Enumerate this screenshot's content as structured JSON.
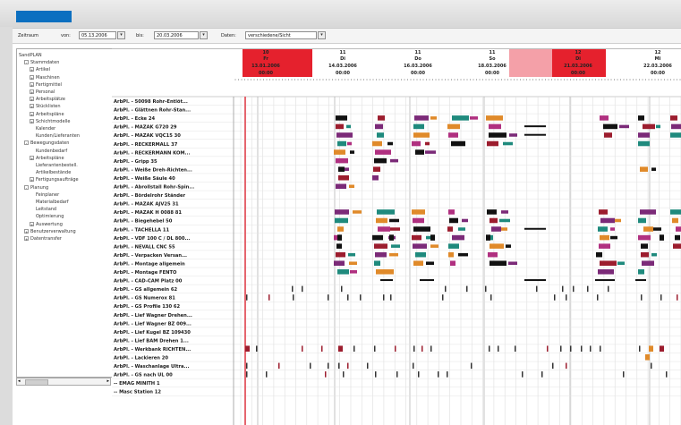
{
  "toolbar": {
    "zeitraum_label": "Zeitraum",
    "von_label": "von:",
    "von_value": "05.13.2006",
    "bis_label": "bis:",
    "bis_value": "20.03.2006",
    "daten_label": "Daten:",
    "daten_value": "verschiedene/Sicht"
  },
  "tree": [
    {
      "label": "SandPLAN",
      "toggle": "",
      "level": 0
    },
    {
      "label": "Stammdaten",
      "toggle": "-",
      "level": 1
    },
    {
      "label": "Artikel",
      "toggle": "+",
      "level": 2
    },
    {
      "label": "Maschinen",
      "toggle": "+",
      "level": 2
    },
    {
      "label": "Fertigmittel",
      "toggle": "+",
      "level": 2
    },
    {
      "label": "Personal",
      "toggle": "+",
      "level": 2
    },
    {
      "label": "Arbeitsplätze",
      "toggle": "+",
      "level": 2
    },
    {
      "label": "Stücklisten",
      "toggle": "+",
      "level": 2
    },
    {
      "label": "Arbeitspläne",
      "toggle": "+",
      "level": 2
    },
    {
      "label": "Schichtmodelle",
      "toggle": "+",
      "level": 2
    },
    {
      "label": "Kalender",
      "toggle": "",
      "level": 2
    },
    {
      "label": "Kunden/Lieferanten",
      "toggle": "",
      "level": 2
    },
    {
      "label": "Bewegungsdaten",
      "toggle": "-",
      "level": 1
    },
    {
      "label": "Kundenbedarf",
      "toggle": "",
      "level": 2
    },
    {
      "label": "Arbeitspläne",
      "toggle": "+",
      "level": 2
    },
    {
      "label": "Lieferantenbestell.",
      "toggle": "",
      "level": 2
    },
    {
      "label": "Artikelbestände",
      "toggle": "",
      "level": 2
    },
    {
      "label": "Fertigungsaufträge",
      "toggle": "+",
      "level": 2
    },
    {
      "label": "Planung",
      "toggle": "-",
      "level": 1
    },
    {
      "label": "Feinplaner",
      "toggle": "",
      "level": 2
    },
    {
      "label": "Materialbedarf",
      "toggle": "",
      "level": 2
    },
    {
      "label": "Leitstand",
      "toggle": "",
      "level": 2
    },
    {
      "label": "Optimierung",
      "toggle": "",
      "level": 2
    },
    {
      "label": "Auswertung",
      "toggle": "+",
      "level": 2
    },
    {
      "label": "Benutzerverwaltung",
      "toggle": "+",
      "level": 1
    },
    {
      "label": "Datentransfer",
      "toggle": "+",
      "level": 1
    }
  ],
  "rows": [
    "ArbPl. - 50098 Rohr-Entlöt...",
    "ArbPl. - Glättnen Rohr-Stan...",
    "ArbPl. - Ecke 24",
    "ArbPl. - MAZAK G720 29",
    "ArbPl. - MAZAK VQC15 30",
    "ArbPl. - RECKERMALL 37",
    "ArbPl. - RECKERMANN KOM...",
    "ArbPl. - Gripp 35",
    "ArbPl. - Weiße Dreh-Richten...",
    "ArbPl. - Weiße Säule 40",
    "ArbPl. - Abrollstall Rohr-Spin...",
    "ArbPl. - Bördelrohr Ständer",
    "ArbPl. - MAZAK AJV25 31",
    "ArbPl. - MAZAK H 0088 81",
    "ArbPl. - Biegehebel 50",
    "ArbPl. - TACHELLA 11",
    "ArbPl. - VDF 100 C / DL 800...",
    "ArbPl. - NEVALL CNC 55",
    "ArbPl. - Verpacken Versan...",
    "ArbPl. - Montage allgemein",
    "ArbPl. - Montage FENTO",
    "ArbPl. - CAD-CAM Platz 00",
    "ArbPl. - GS allgemein 62",
    "ArbPl. - GS Numerox 81",
    "ArbPl. - GS Profile 130 62",
    "ArbPl. - Lief Wagner Drehen...",
    "ArbPl. - Lief Wagner BZ 009...",
    "ArbPl. - Lief Kugel BZ 109430",
    "ArbPl. - Lief BAM Drehen 1...",
    "ArbPl. - Werkbank RICHTEN...",
    "ArbPl. - Lackieren 20",
    "ArbPl. - Waschanlage Ultra...",
    "ArbPl. - GS nach UL 00",
    "-- EMAG MINITH 1",
    "-- Masc Station 12"
  ],
  "days": [
    {
      "num": "10",
      "wd": "Fr",
      "date": "13.01.2006",
      "time": "00:00"
    },
    {
      "num": "11",
      "wd": "Di",
      "date": "14.03.2006",
      "time": "00:00"
    },
    {
      "num": "11",
      "wd": "Do",
      "date": "16.03.2006",
      "time": "00:00"
    },
    {
      "num": "11",
      "wd": "So",
      "date": "18.03.2006",
      "time": "00:00"
    },
    {
      "num": "12",
      "wd": "Di",
      "date": "21.03.2006",
      "time": "00:00"
    },
    {
      "num": "12",
      "wd": "Mi",
      "date": "22.03.2006",
      "time": "00:00"
    }
  ],
  "colors": {
    "accent": "#0b6fc0",
    "weekend_header": "#e5212d",
    "weekend_header_light": "#f4a0a8",
    "marker_line": "#e5656e",
    "bar_dark": "#111111",
    "bar_red": "#9c1d2e",
    "bar_purple": "#7b2a78",
    "bar_teal": "#1f8a7d",
    "bar_orange": "#e08a2a",
    "bar_magenta": "#b03080"
  }
}
